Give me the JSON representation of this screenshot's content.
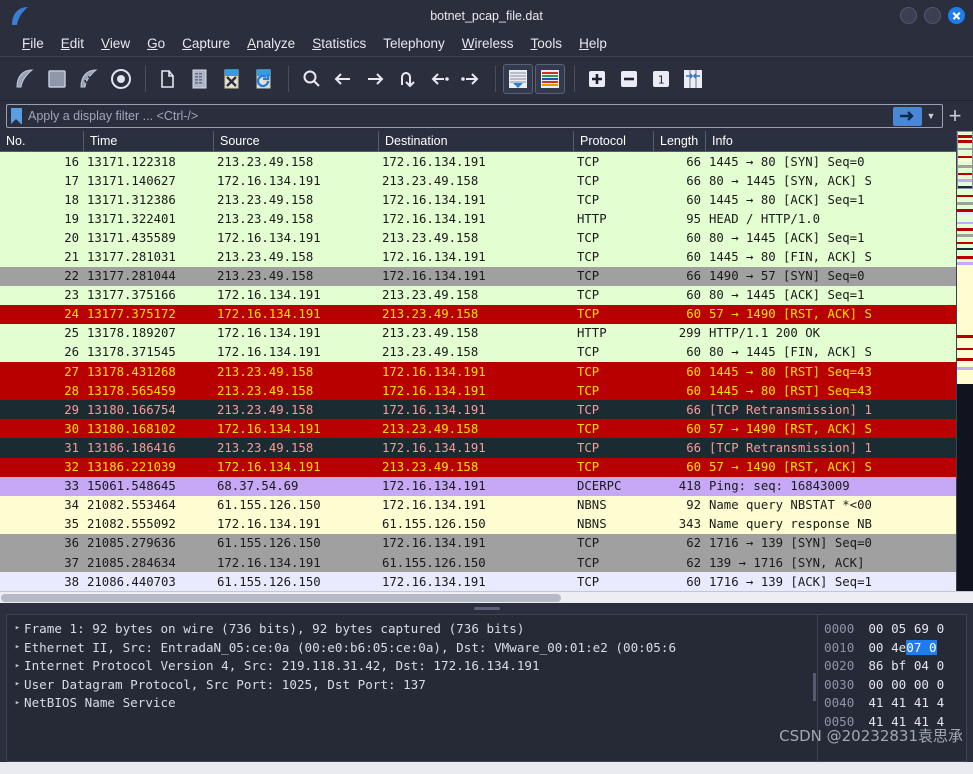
{
  "window": {
    "title": "botnet_pcap_file.dat",
    "logo_icon": "wireshark-fin-logo",
    "buttons": [
      {
        "name": "minimize",
        "icon": "minimize-icon"
      },
      {
        "name": "maximize",
        "icon": "maximize-icon"
      },
      {
        "name": "close",
        "icon": "close-icon"
      }
    ]
  },
  "menubar": {
    "items": [
      {
        "label": "File",
        "mnemonic": "F"
      },
      {
        "label": "Edit",
        "mnemonic": "E"
      },
      {
        "label": "View",
        "mnemonic": "V"
      },
      {
        "label": "Go",
        "mnemonic": "G"
      },
      {
        "label": "Capture",
        "mnemonic": "C"
      },
      {
        "label": "Analyze",
        "mnemonic": "A"
      },
      {
        "label": "Statistics",
        "mnemonic": "S"
      },
      {
        "label": "Telephony",
        "mnemonic": "T"
      },
      {
        "label": "Wireless",
        "mnemonic": "W"
      },
      {
        "label": "Tools",
        "mnemonic": "T"
      },
      {
        "label": "Help",
        "mnemonic": "H"
      }
    ]
  },
  "toolbar": {
    "buttons": [
      {
        "name": "start-capture-button",
        "icon": "shark-fin-icon"
      },
      {
        "name": "stop-capture-button",
        "icon": "stop-square-icon"
      },
      {
        "name": "restart-capture-button",
        "icon": "shark-fin-restart-icon"
      },
      {
        "name": "capture-options-button",
        "icon": "gear-target-icon"
      },
      {
        "name": "open-file-button",
        "icon": "folder-icon"
      },
      {
        "name": "save-file-button",
        "icon": "save-document-icon"
      },
      {
        "name": "close-file-button",
        "icon": "close-document-icon"
      },
      {
        "name": "reload-file-button",
        "icon": "reload-document-icon"
      },
      {
        "name": "find-packet-button",
        "icon": "search-icon"
      },
      {
        "name": "go-back-button",
        "icon": "arrow-left-icon"
      },
      {
        "name": "go-forward-button",
        "icon": "arrow-right-icon"
      },
      {
        "name": "go-to-packet-button",
        "icon": "goto-packet-icon"
      },
      {
        "name": "go-to-first-button",
        "icon": "go-first-icon"
      },
      {
        "name": "go-to-last-button",
        "icon": "go-last-icon"
      },
      {
        "name": "auto-scroll-button",
        "icon": "auto-scroll-icon"
      },
      {
        "name": "colorize-button",
        "icon": "colorize-icon"
      },
      {
        "name": "zoom-in-button",
        "icon": "plus-icon"
      },
      {
        "name": "zoom-out-button",
        "icon": "minus-icon"
      },
      {
        "name": "zoom-reset-button",
        "icon": "zoom-100-icon"
      },
      {
        "name": "resize-columns-button",
        "icon": "resize-columns-icon"
      }
    ]
  },
  "filterbar": {
    "placeholder": "Apply a display filter ... <Ctrl-/>",
    "value": "",
    "bookmark_icon": "bookmark-icon",
    "apply_icon": "arrow-right-apply-icon",
    "caret_icon": "chevron-down-icon",
    "add_label": "+"
  },
  "packet_list": {
    "columns": [
      {
        "label": "No.",
        "key": "no"
      },
      {
        "label": "Time",
        "key": "time"
      },
      {
        "label": "Source",
        "key": "source"
      },
      {
        "label": "Destination",
        "key": "destination"
      },
      {
        "label": "Protocol",
        "key": "protocol"
      },
      {
        "label": "Length",
        "key": "length"
      },
      {
        "label": "Info",
        "key": "info"
      }
    ],
    "rows": [
      {
        "no": "16",
        "time": "13171.122318",
        "source": "213.23.49.158",
        "destination": "172.16.134.191",
        "protocol": "TCP",
        "length": "66",
        "info": "1445 → 80 [SYN] Seq=0",
        "style": "r-green"
      },
      {
        "no": "17",
        "time": "13171.140627",
        "source": "172.16.134.191",
        "destination": "213.23.49.158",
        "protocol": "TCP",
        "length": "66",
        "info": "80 → 1445 [SYN, ACK] S",
        "style": "r-green"
      },
      {
        "no": "18",
        "time": "13171.312386",
        "source": "213.23.49.158",
        "destination": "172.16.134.191",
        "protocol": "TCP",
        "length": "60",
        "info": "1445 → 80 [ACK] Seq=1",
        "style": "r-green"
      },
      {
        "no": "19",
        "time": "13171.322401",
        "source": "213.23.49.158",
        "destination": "172.16.134.191",
        "protocol": "HTTP",
        "length": "95",
        "info": "HEAD / HTTP/1.0",
        "style": "r-green"
      },
      {
        "no": "20",
        "time": "13171.435589",
        "source": "172.16.134.191",
        "destination": "213.23.49.158",
        "protocol": "TCP",
        "length": "60",
        "info": "80 → 1445 [ACK] Seq=1",
        "style": "r-green"
      },
      {
        "no": "21",
        "time": "13177.281031",
        "source": "213.23.49.158",
        "destination": "172.16.134.191",
        "protocol": "TCP",
        "length": "60",
        "info": "1445 → 80 [FIN, ACK] S",
        "style": "r-green"
      },
      {
        "no": "22",
        "time": "13177.281044",
        "source": "213.23.49.158",
        "destination": "172.16.134.191",
        "protocol": "TCP",
        "length": "66",
        "info": "1490 → 57 [SYN] Seq=0",
        "style": "r-gray"
      },
      {
        "no": "23",
        "time": "13177.375166",
        "source": "172.16.134.191",
        "destination": "213.23.49.158",
        "protocol": "TCP",
        "length": "60",
        "info": "80 → 1445 [ACK] Seq=1",
        "style": "r-green"
      },
      {
        "no": "24",
        "time": "13177.375172",
        "source": "172.16.134.191",
        "destination": "213.23.49.158",
        "protocol": "TCP",
        "length": "60",
        "info": "57 → 1490 [RST, ACK] S",
        "style": "r-red"
      },
      {
        "no": "25",
        "time": "13178.189207",
        "source": "172.16.134.191",
        "destination": "213.23.49.158",
        "protocol": "HTTP",
        "length": "299",
        "info": "HTTP/1.1 200 OK",
        "style": "r-green"
      },
      {
        "no": "26",
        "time": "13178.371545",
        "source": "172.16.134.191",
        "destination": "213.23.49.158",
        "protocol": "TCP",
        "length": "60",
        "info": "80 → 1445 [FIN, ACK] S",
        "style": "r-green"
      },
      {
        "no": "27",
        "time": "13178.431268",
        "source": "213.23.49.158",
        "destination": "172.16.134.191",
        "protocol": "TCP",
        "length": "60",
        "info": "1445 → 80 [RST] Seq=43",
        "style": "r-red"
      },
      {
        "no": "28",
        "time": "13178.565459",
        "source": "213.23.49.158",
        "destination": "172.16.134.191",
        "protocol": "TCP",
        "length": "60",
        "info": "1445 → 80 [RST] Seq=43",
        "style": "r-red"
      },
      {
        "no": "29",
        "time": "13180.166754",
        "source": "213.23.49.158",
        "destination": "172.16.134.191",
        "protocol": "TCP",
        "length": "66",
        "info": "[TCP Retransmission] 1",
        "style": "r-dark"
      },
      {
        "no": "30",
        "time": "13180.168102",
        "source": "172.16.134.191",
        "destination": "213.23.49.158",
        "protocol": "TCP",
        "length": "60",
        "info": "57 → 1490 [RST, ACK] S",
        "style": "r-red"
      },
      {
        "no": "31",
        "time": "13186.186416",
        "source": "213.23.49.158",
        "destination": "172.16.134.191",
        "protocol": "TCP",
        "length": "66",
        "info": "[TCP Retransmission] 1",
        "style": "r-dark"
      },
      {
        "no": "32",
        "time": "13186.221039",
        "source": "172.16.134.191",
        "destination": "213.23.49.158",
        "protocol": "TCP",
        "length": "60",
        "info": "57 → 1490 [RST, ACK] S",
        "style": "r-red"
      },
      {
        "no": "33",
        "time": "15061.548645",
        "source": "68.37.54.69",
        "destination": "172.16.134.191",
        "protocol": "DCERPC",
        "length": "418",
        "info": "Ping: seq: 16843009",
        "style": "r-purple"
      },
      {
        "no": "34",
        "time": "21082.553464",
        "source": "61.155.126.150",
        "destination": "172.16.134.191",
        "protocol": "NBNS",
        "length": "92",
        "info": "Name query NBSTAT *<00",
        "style": "r-yellow"
      },
      {
        "no": "35",
        "time": "21082.555092",
        "source": "172.16.134.191",
        "destination": "61.155.126.150",
        "protocol": "NBNS",
        "length": "343",
        "info": "Name query response NB",
        "style": "r-yellow"
      },
      {
        "no": "36",
        "time": "21085.279636",
        "source": "61.155.126.150",
        "destination": "172.16.134.191",
        "protocol": "TCP",
        "length": "62",
        "info": "1716 → 139 [SYN] Seq=0",
        "style": "r-gray"
      },
      {
        "no": "37",
        "time": "21085.284634",
        "source": "172.16.134.191",
        "destination": "61.155.126.150",
        "protocol": "TCP",
        "length": "62",
        "info": "139 → 1716 [SYN, ACK]",
        "style": "r-gray"
      },
      {
        "no": "38",
        "time": "21086.440703",
        "source": "61.155.126.150",
        "destination": "172.16.134.191",
        "protocol": "TCP",
        "length": "60",
        "info": "1716 → 139 [ACK] Seq=1",
        "style": "r-lav"
      }
    ],
    "minimap_stripes": [
      {
        "color": "#e3ffd2",
        "h": 4
      },
      {
        "color": "#b80000",
        "h": 3
      },
      {
        "color": "#e3ffd2",
        "h": 2
      },
      {
        "color": "#b80000",
        "h": 3
      },
      {
        "color": "#e3ffd2",
        "h": 5
      },
      {
        "color": "#a0a0a0",
        "h": 2
      },
      {
        "color": "#e3ffd2",
        "h": 6
      },
      {
        "color": "#b80000",
        "h": 2
      },
      {
        "color": "#fefdd2",
        "h": 3
      },
      {
        "color": "#e3ffd2",
        "h": 4
      },
      {
        "color": "#a0a0a0",
        "h": 3
      },
      {
        "color": "#e3ffd2",
        "h": 5
      },
      {
        "color": "#b80000",
        "h": 2
      },
      {
        "color": "#e3ffd2",
        "h": 4
      },
      {
        "color": "#c6a8f7",
        "h": 3
      },
      {
        "color": "#e3ffd2",
        "h": 4
      },
      {
        "color": "#1b2b32",
        "h": 3
      },
      {
        "color": "#e3ffd2",
        "h": 6
      },
      {
        "color": "#b80000",
        "h": 2
      },
      {
        "color": "#e3ffd2",
        "h": 5
      },
      {
        "color": "#a0a0a0",
        "h": 3
      },
      {
        "color": "#e3ffd2",
        "h": 4
      },
      {
        "color": "#b80000",
        "h": 3
      },
      {
        "color": "#eaeaff",
        "h": 3
      },
      {
        "color": "#e3ffd2",
        "h": 7
      },
      {
        "color": "#c6a8f7",
        "h": 2
      },
      {
        "color": "#e3ffd2",
        "h": 4
      },
      {
        "color": "#b80000",
        "h": 3
      },
      {
        "color": "#e3ffd2",
        "h": 3
      },
      {
        "color": "#a0a0a0",
        "h": 3
      },
      {
        "color": "#e3ffd2",
        "h": 5
      },
      {
        "color": "#b80000",
        "h": 2
      },
      {
        "color": "#e3ffd2",
        "h": 4
      },
      {
        "color": "#1b2b32",
        "h": 2
      },
      {
        "color": "#e3ffd2",
        "h": 6
      },
      {
        "color": "#b80000",
        "h": 3
      },
      {
        "color": "#e3ffd2",
        "h": 3
      },
      {
        "color": "#c6a8f7",
        "h": 3
      },
      {
        "color": "#fefdd2",
        "h": 70
      },
      {
        "color": "#b80000",
        "h": 3
      },
      {
        "color": "#fefdd2",
        "h": 10
      },
      {
        "color": "#b80000",
        "h": 2
      },
      {
        "color": "#fefdd2",
        "h": 8
      },
      {
        "color": "#b80000",
        "h": 3
      },
      {
        "color": "#fefdd2",
        "h": 6
      },
      {
        "color": "#c6a8f7",
        "h": 3
      },
      {
        "color": "#fefdd2",
        "h": 14
      }
    ]
  },
  "detail_pane": {
    "rows": [
      {
        "triangle": "▸",
        "text": "Frame 1: 92 bytes on wire (736 bits), 92 bytes captured (736 bits)"
      },
      {
        "triangle": "▸",
        "text": "Ethernet II, Src: EntradaN_05:ce:0a (00:e0:b6:05:ce:0a), Dst: VMware_00:01:e2 (00:05:6"
      },
      {
        "triangle": "▸",
        "text": "Internet Protocol Version 4, Src: 219.118.31.42, Dst: 172.16.134.191"
      },
      {
        "triangle": "▸",
        "text": "User Datagram Protocol, Src Port: 1025, Dst Port: 137"
      },
      {
        "triangle": "▸",
        "text": "NetBIOS Name Service"
      }
    ]
  },
  "hex_pane": {
    "rows": [
      {
        "offset": "0000",
        "pre": "00 05 69 0",
        "sel": "",
        "post": ""
      },
      {
        "offset": "0010",
        "pre": "00 4e ",
        "sel": "07 0",
        "post": ""
      },
      {
        "offset": "0020",
        "pre": "86 bf 04 0",
        "sel": "",
        "post": ""
      },
      {
        "offset": "0030",
        "pre": "00 00 00 0",
        "sel": "",
        "post": ""
      },
      {
        "offset": "0040",
        "pre": "41 41 41 4",
        "sel": "",
        "post": ""
      },
      {
        "offset": "0050",
        "pre": "41 41 41 4",
        "sel": "",
        "post": ""
      }
    ]
  },
  "watermark": {
    "text": "CSDN @20232831袁思承"
  },
  "colors": {
    "window_bg": "#2b2f3d",
    "accent": "#1f7ced",
    "row_green": "#e3ffd2",
    "row_red": "#b80000",
    "row_gray": "#a0a0a0",
    "row_dark": "#1b2b32",
    "row_purple": "#c6a8f7",
    "row_yellow": "#fefdd2",
    "row_lavender": "#eaeaff"
  }
}
